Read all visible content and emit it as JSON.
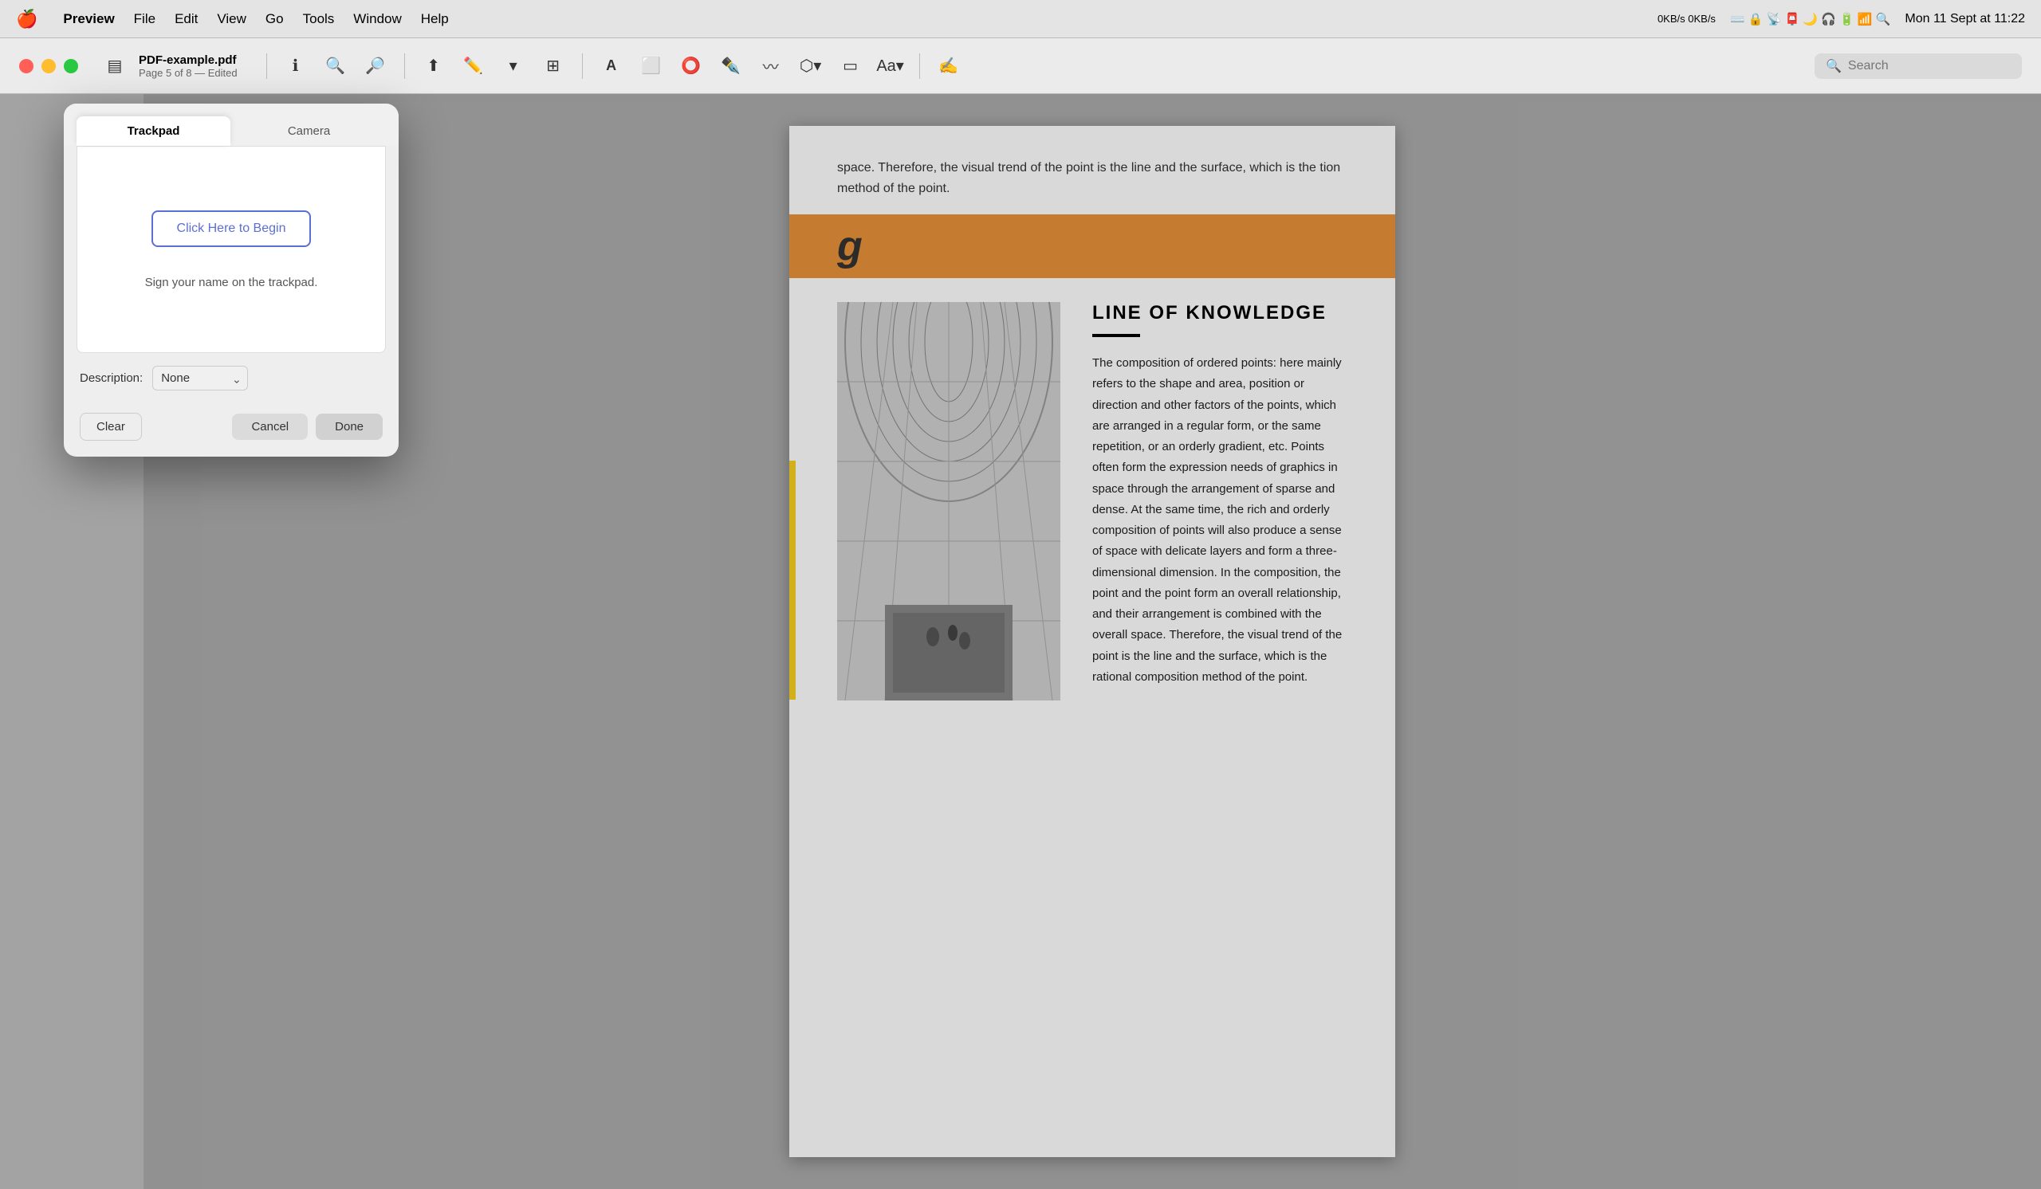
{
  "menubar": {
    "apple": "🍎",
    "app_name": "Preview",
    "items": [
      "File",
      "Edit",
      "View",
      "Go",
      "Tools",
      "Window",
      "Help"
    ],
    "network": "0KB/s\n0KB/s",
    "time": "Mon 11 Sept at 11:22"
  },
  "toolbar": {
    "window_title": "PDF-example.pdf",
    "window_subtitle": "Page 5 of 8 — Edited",
    "search_placeholder": "Search"
  },
  "dialog": {
    "tab_trackpad": "Trackpad",
    "tab_camera": "Camera",
    "click_here_label": "Click Here to Begin",
    "sign_instruction": "Sign your name on the trackpad.",
    "description_label": "Description:",
    "description_value": "None",
    "btn_clear": "Clear",
    "btn_cancel": "Cancel",
    "btn_done": "Done"
  },
  "pdf": {
    "text_top": "space. Therefore, the visual trend of the point is the line and the surface, which is the\ntion method of the point.",
    "banner_letter": "g",
    "section_title": "LINE OF KNOWLEDGE",
    "body_text": "The composition of ordered points: here mainly refers to the shape and area, position or direction and other factors of the points, which are arranged in a regular form, or the same repetition, or an orderly gradient, etc. Points often form the expression needs of graphics in space through the arrangement of sparse and dense. At the same time, the rich and orderly composition of points will also produce a sense of space with delicate layers and form a three-dimensional dimension. In the composition, the point and the point form an overall relationship, and their arrangement is combined with the overall space. Therefore, the visual trend of the point is the line and the surface, which is the rational composition method of the point."
  }
}
